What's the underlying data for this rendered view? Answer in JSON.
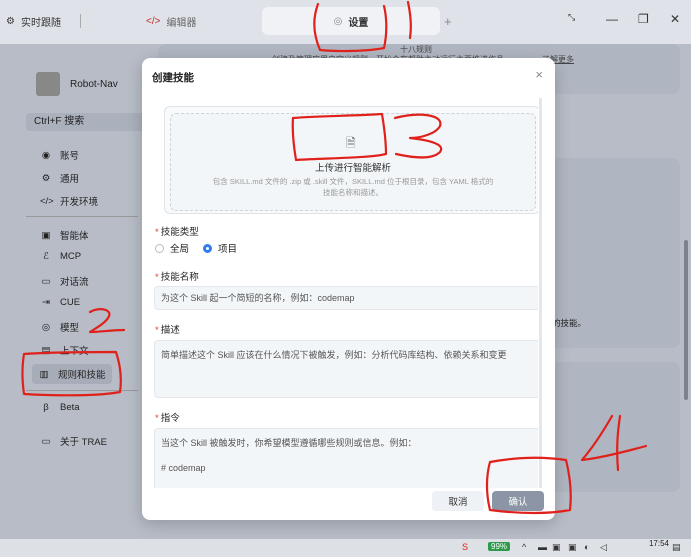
{
  "tabs": [
    {
      "label": "实时跟随"
    },
    {
      "label": "编辑器"
    },
    {
      "label": "设置"
    }
  ],
  "tab_new": "+",
  "background": {
    "profile_name": "Robot-Nav",
    "search_label": "Ctrl+F 搜索",
    "top_text_1": "十八规则",
    "top_text_2": "创建及管理应用自定义规则，开始会在帮助主动运行主要推进作品",
    "top_link": "了解更多",
    "side_text": "的技能。",
    "sidebar_items": [
      {
        "label": "账号",
        "icon": "user-icon"
      },
      {
        "label": "通用",
        "icon": "gear-icon"
      },
      {
        "label": "开发环境",
        "icon": "code-icon"
      },
      {
        "label": "智能体",
        "icon": "agent-icon"
      },
      {
        "label": "MCP",
        "icon": "mcp-icon"
      },
      {
        "label": "对话流",
        "icon": "chat-icon"
      },
      {
        "label": "CUE",
        "icon": "cue-icon"
      },
      {
        "label": "模型",
        "icon": "model-icon"
      },
      {
        "label": "上下文",
        "icon": "context-icon"
      },
      {
        "label": "规则和技能",
        "icon": "rules-icon"
      },
      {
        "label": "Beta",
        "icon": "beta-icon"
      },
      {
        "label": "关于 TRAE",
        "icon": "info-icon"
      }
    ]
  },
  "modal": {
    "title": "创建技能",
    "close": "×",
    "upload_title": "上传进行智能解析",
    "upload_desc": "包含 SKILL.md 文件的 .zip 或 .skill 文件，SKILL.md 位于根目录，包含 YAML 格式的技能名称和描述。",
    "type_label": "技能类型",
    "type_options": [
      "全局",
      "项目"
    ],
    "type_selected": "项目",
    "name_label": "技能名称",
    "name_placeholder": "为这个 Skill 起一个简短的名称，例如：codemap",
    "desc_label": "描述",
    "desc_placeholder": "简单描述这个 Skill 应该在什么情况下被触发，例如：分析代码库结构、依赖关系和变更",
    "instr_label": "指令",
    "instr_placeholder_1": "当这个 Skill 被触发时，你希望模型遵循哪些规则或信息。例如：",
    "instr_placeholder_2": "# codemap",
    "cancel": "取消",
    "confirm": "确认"
  },
  "taskbar": {
    "battery": "99%",
    "time": "17:54"
  },
  "annotations": [
    "1",
    "2",
    "3",
    "4"
  ],
  "colors": {
    "accent": "#2f7bf5",
    "required": "#e03c3c",
    "annotation": "#e0201a"
  }
}
